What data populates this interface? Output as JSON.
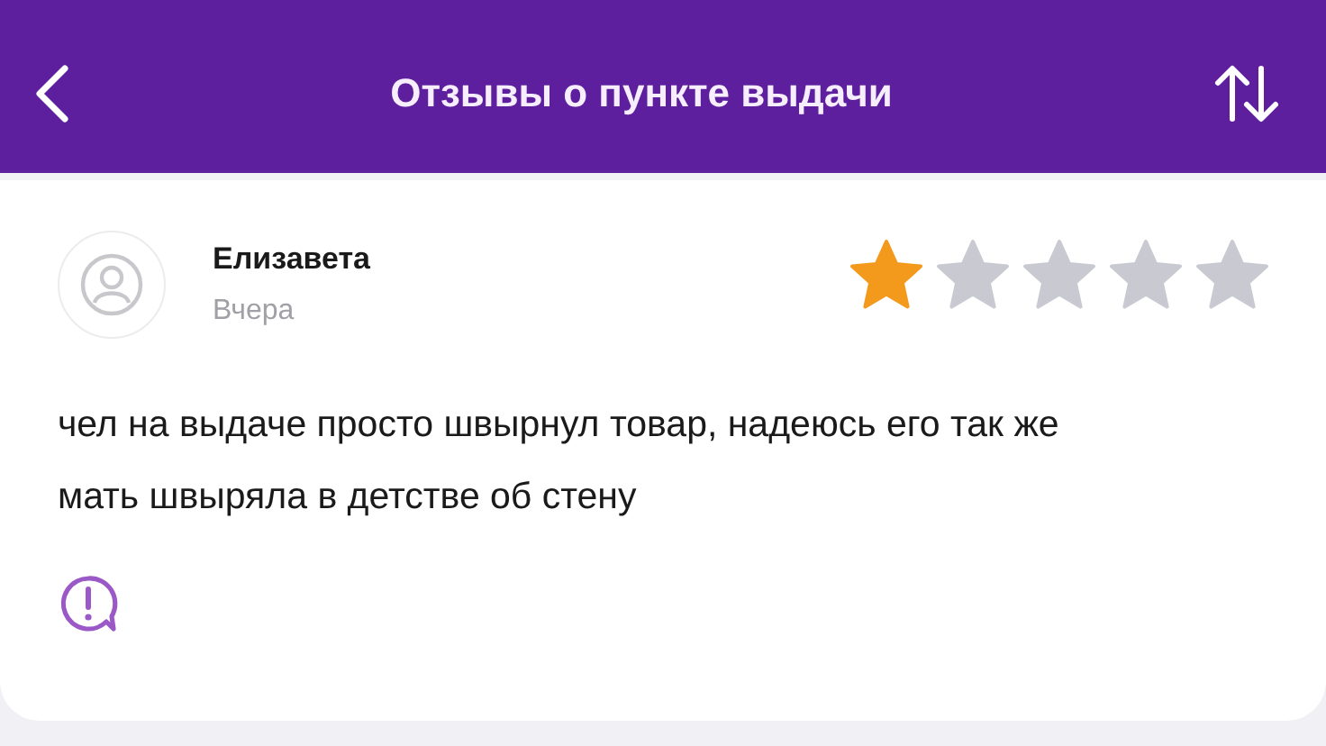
{
  "header": {
    "title": "Отзывы о пункте выдачи"
  },
  "review": {
    "author": "Елизавета",
    "date": "Вчера",
    "stars": 1,
    "text": "чел на выдаче просто швырнул товар, надеюсь его так же мать швыряла в детстве об стену"
  }
}
